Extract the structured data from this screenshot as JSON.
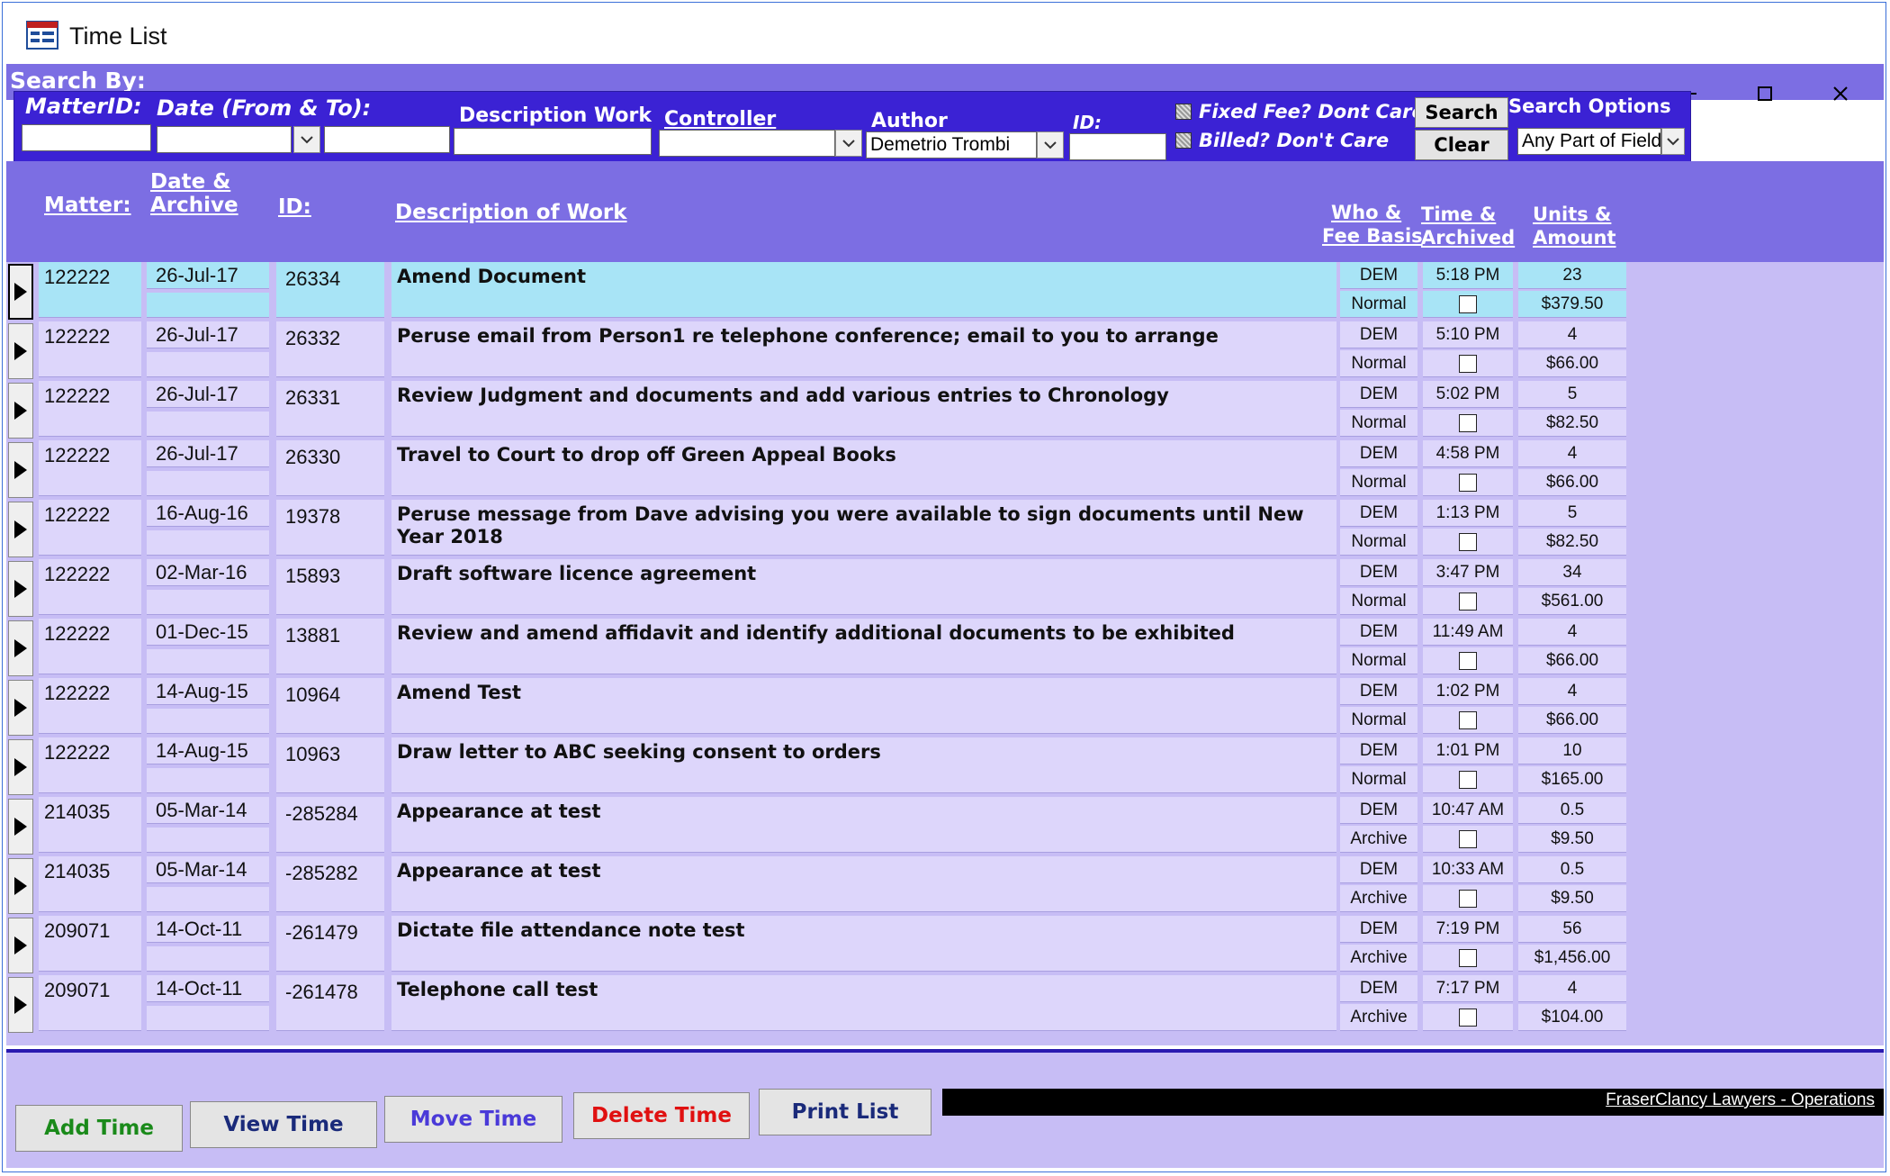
{
  "window": {
    "title": "Time List",
    "minimize_icon": "minimize-icon",
    "maximize_icon": "maximize-icon",
    "close_icon": "close-icon"
  },
  "search": {
    "search_by_label": "Search By:",
    "matter_id_label": "MatterID:",
    "matter_id_value": "",
    "date_label": "Date (From & To):",
    "date_from_value": "",
    "date_to_value": "",
    "description_label": "Description Work",
    "description_value": "",
    "controller_label": "Controller",
    "controller_value": "",
    "author_label": "Author",
    "author_value": "Demetrio Trombi",
    "id_label": "ID:",
    "id_value": "",
    "fixed_fee_label": "Fixed Fee? Dont Care",
    "billed_label": "Billed? Don't Care",
    "search_button": "Search",
    "clear_button": "Clear",
    "search_options_label": "Search Options",
    "search_options_value": "Any Part of Field"
  },
  "columns": {
    "matter": "Matter:",
    "date_line1": "Date &",
    "date_line2": "Archive",
    "id": "ID:",
    "description": "Description of Work",
    "who_line1": "Who &",
    "who_line2": "Fee Basis",
    "time_line1": "Time &",
    "time_line2": "Archived",
    "units_line1": "Units &",
    "units_line2": "Amount"
  },
  "rows": [
    {
      "matter": "122222",
      "date": "26-Jul-17",
      "id": "26334",
      "description": "Amend Document",
      "who": "DEM",
      "fee_basis": "Normal",
      "time": "5:18 PM",
      "units": "23",
      "amount": "$379.50"
    },
    {
      "matter": "122222",
      "date": "26-Jul-17",
      "id": "26332",
      "description": "Peruse email from Person1 re telephone conference; email to you to arrange",
      "who": "DEM",
      "fee_basis": "Normal",
      "time": "5:10 PM",
      "units": "4",
      "amount": "$66.00"
    },
    {
      "matter": "122222",
      "date": "26-Jul-17",
      "id": "26331",
      "description": "Review Judgment and documents and add various entries to Chronology",
      "who": "DEM",
      "fee_basis": "Normal",
      "time": "5:02 PM",
      "units": "5",
      "amount": "$82.50"
    },
    {
      "matter": "122222",
      "date": "26-Jul-17",
      "id": "26330",
      "description": "Travel to Court to drop off Green Appeal Books",
      "who": "DEM",
      "fee_basis": "Normal",
      "time": "4:58 PM",
      "units": "4",
      "amount": "$66.00"
    },
    {
      "matter": "122222",
      "date": "16-Aug-16",
      "id": "19378",
      "description": "Peruse message from Dave advising you were available to sign documents until New Year 2018",
      "who": "DEM",
      "fee_basis": "Normal",
      "time": "1:13 PM",
      "units": "5",
      "amount": "$82.50"
    },
    {
      "matter": "122222",
      "date": "02-Mar-16",
      "id": "15893",
      "description": "Draft software licence agreement",
      "who": "DEM",
      "fee_basis": "Normal",
      "time": "3:47 PM",
      "units": "34",
      "amount": "$561.00"
    },
    {
      "matter": "122222",
      "date": "01-Dec-15",
      "id": "13881",
      "description": "Review  and amend affidavit and identify additional documents to be exhibited",
      "who": "DEM",
      "fee_basis": "Normal",
      "time": "11:49 AM",
      "units": "4",
      "amount": "$66.00"
    },
    {
      "matter": "122222",
      "date": "14-Aug-15",
      "id": "10964",
      "description": "Amend Test",
      "who": "DEM",
      "fee_basis": "Normal",
      "time": "1:02 PM",
      "units": "4",
      "amount": "$66.00"
    },
    {
      "matter": "122222",
      "date": "14-Aug-15",
      "id": "10963",
      "description": "Draw letter to ABC seeking consent to orders",
      "who": "DEM",
      "fee_basis": "Normal",
      "time": "1:01 PM",
      "units": "10",
      "amount": "$165.00"
    },
    {
      "matter": "214035",
      "date": "05-Mar-14",
      "id": "-285284",
      "description": "Appearance at test",
      "who": "DEM",
      "fee_basis": "Archive",
      "time": "10:47 AM",
      "units": "0.5",
      "amount": "$9.50"
    },
    {
      "matter": "214035",
      "date": "05-Mar-14",
      "id": "-285282",
      "description": "Appearance at test",
      "who": "DEM",
      "fee_basis": "Archive",
      "time": "10:33 AM",
      "units": "0.5",
      "amount": "$9.50"
    },
    {
      "matter": "209071",
      "date": "14-Oct-11",
      "id": "-261479",
      "description": "Dictate file attendance note test",
      "who": "DEM",
      "fee_basis": "Archive",
      "time": "7:19 PM",
      "units": "56",
      "amount": "$1,456.00"
    },
    {
      "matter": "209071",
      "date": "14-Oct-11",
      "id": "-261478",
      "description": "Telephone call test",
      "who": "DEM",
      "fee_basis": "Archive",
      "time": "7:17 PM",
      "units": "4",
      "amount": "$104.00"
    }
  ],
  "footer": {
    "add_time": "Add Time",
    "view_time": "View Time",
    "move_time": "Move Time",
    "delete_time": "Delete Time",
    "print_list": "Print List",
    "company": "FraserClancy Lawyers - Operations"
  },
  "colors": {
    "header_band": "#7c6ee3",
    "filter_panel": "#3b22d4",
    "list_bg": "#c7bdf5",
    "row_bg": "#ddd6fb",
    "active_row": "#a8e4f6",
    "add_time_text": "#1a8a1a",
    "view_time_text": "#1a2a7a",
    "move_time_text": "#4a3ad8",
    "delete_time_text": "#e01010",
    "print_list_text": "#1a2a7a"
  }
}
